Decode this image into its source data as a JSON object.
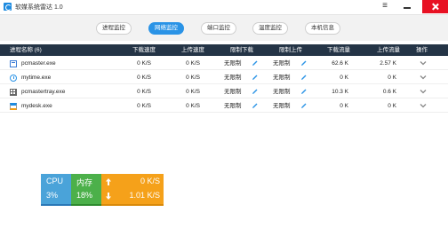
{
  "app": {
    "title": "软媒系统雷达 1.0",
    "menu_glyph": "≡"
  },
  "tabs": [
    {
      "label": "进程监控",
      "active": false
    },
    {
      "label": "网络监控",
      "active": true
    },
    {
      "label": "端口监控",
      "active": false
    },
    {
      "label": "温度监控",
      "active": false
    },
    {
      "label": "本机信息",
      "active": false
    }
  ],
  "table": {
    "headers": {
      "name": "进程名称 (6)",
      "download_speed": "下载速度",
      "upload_speed": "上传速度",
      "limit_download": "限制下载",
      "limit_upload": "限制上传",
      "download_traffic": "下载流量",
      "upload_traffic": "上传流量",
      "action": "操作"
    },
    "rows": [
      {
        "icon": "window-icon",
        "name": "pcmaster.exe",
        "down": "0 K/S",
        "up": "0 K/S",
        "limit_down": "无限制",
        "limit_up": "无限制",
        "down_total": "62.6 K",
        "up_total": "2.57 K"
      },
      {
        "icon": "clock-icon",
        "name": "mytime.exe",
        "down": "0 K/S",
        "up": "0 K/S",
        "limit_down": "无限制",
        "limit_up": "无限制",
        "down_total": "0 K",
        "up_total": "0 K"
      },
      {
        "icon": "grid-icon",
        "name": "pcmastertray.exe",
        "down": "0 K/S",
        "up": "0 K/S",
        "limit_down": "无限制",
        "limit_up": "无限制",
        "down_total": "10.3 K",
        "up_total": "0.6 K"
      },
      {
        "icon": "desktop-icon",
        "name": "mydesk.exe",
        "down": "0 K/S",
        "up": "0 K/S",
        "limit_down": "无限制",
        "limit_up": "无限制",
        "down_total": "0 K",
        "up_total": "0 K"
      }
    ]
  },
  "widget": {
    "cpu_label": "CPU",
    "cpu_value": "3%",
    "mem_label": "内存",
    "mem_value": "18%",
    "upload": "0 K/S",
    "download": "1.01 K/S"
  },
  "colors": {
    "active_tab": "#2a93e6",
    "table_header": "#243446",
    "close_button": "#e81123",
    "cpu_tile": "#4aa3d9",
    "mem_tile": "#4cb04a",
    "net_tile": "#f5a11a",
    "edit_icon": "#2a93e6"
  }
}
